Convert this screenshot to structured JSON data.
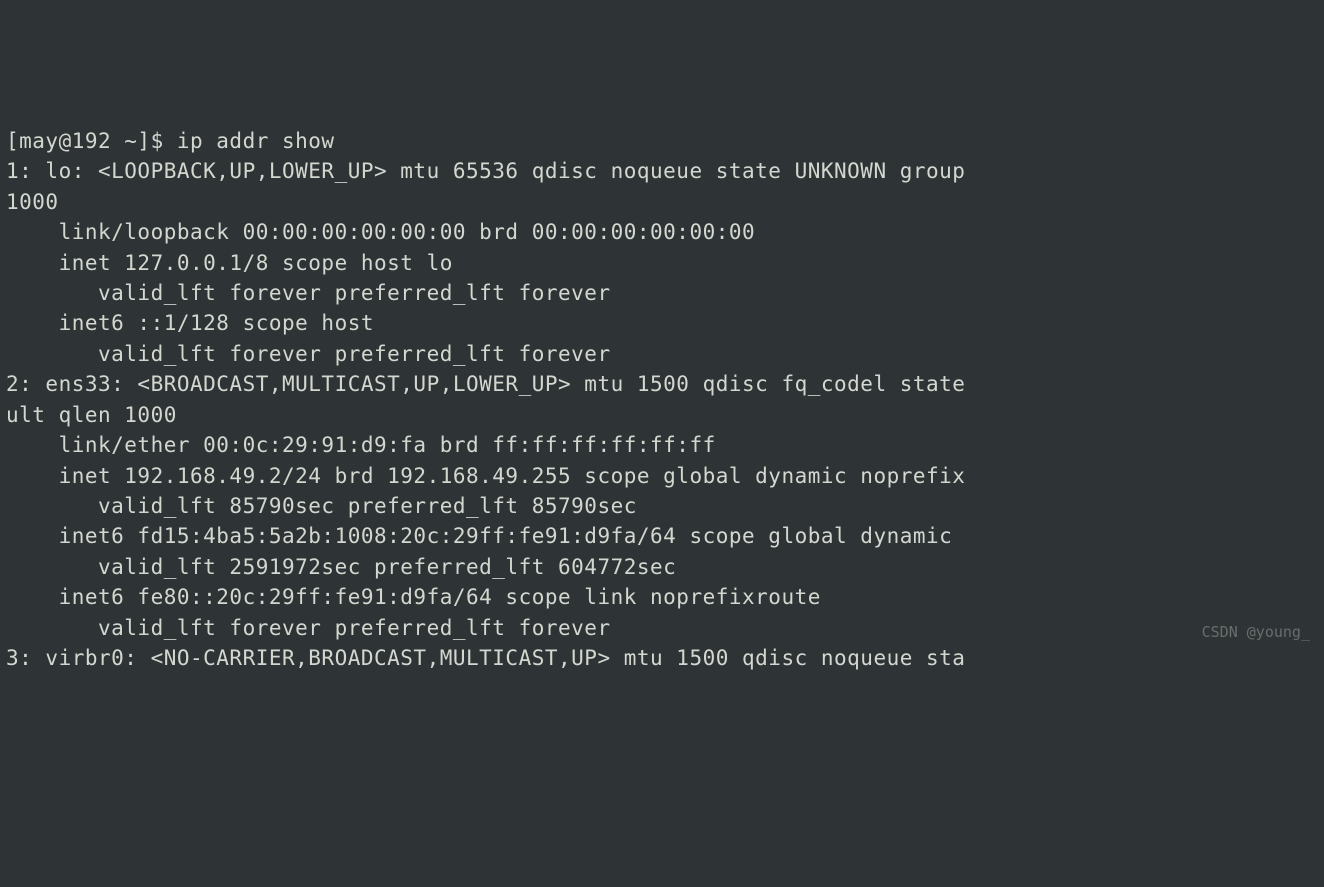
{
  "prompt": {
    "user": "may",
    "host": "192",
    "path": "~",
    "symbol": "$",
    "command": "ip addr show"
  },
  "lines": [
    "[may@192 ~]$ ip addr show",
    "1: lo: <LOOPBACK,UP,LOWER_UP> mtu 65536 qdisc noqueue state UNKNOWN group",
    "1000",
    "    link/loopback 00:00:00:00:00:00 brd 00:00:00:00:00:00",
    "    inet 127.0.0.1/8 scope host lo",
    "       valid_lft forever preferred_lft forever",
    "    inet6 ::1/128 scope host ",
    "       valid_lft forever preferred_lft forever",
    "2: ens33: <BROADCAST,MULTICAST,UP,LOWER_UP> mtu 1500 qdisc fq_codel state",
    "ult qlen 1000",
    "    link/ether 00:0c:29:91:d9:fa brd ff:ff:ff:ff:ff:ff",
    "    inet 192.168.49.2/24 brd 192.168.49.255 scope global dynamic noprefix",
    "       valid_lft 85790sec preferred_lft 85790sec",
    "    inet6 fd15:4ba5:5a2b:1008:20c:29ff:fe91:d9fa/64 scope global dynamic ",
    "       valid_lft 2591972sec preferred_lft 604772sec",
    "    inet6 fe80::20c:29ff:fe91:d9fa/64 scope link noprefixroute ",
    "       valid_lft forever preferred_lft forever",
    "3: virbr0: <NO-CARRIER,BROADCAST,MULTICAST,UP> mtu 1500 qdisc noqueue sta"
  ],
  "watermark": "CSDN @young_"
}
